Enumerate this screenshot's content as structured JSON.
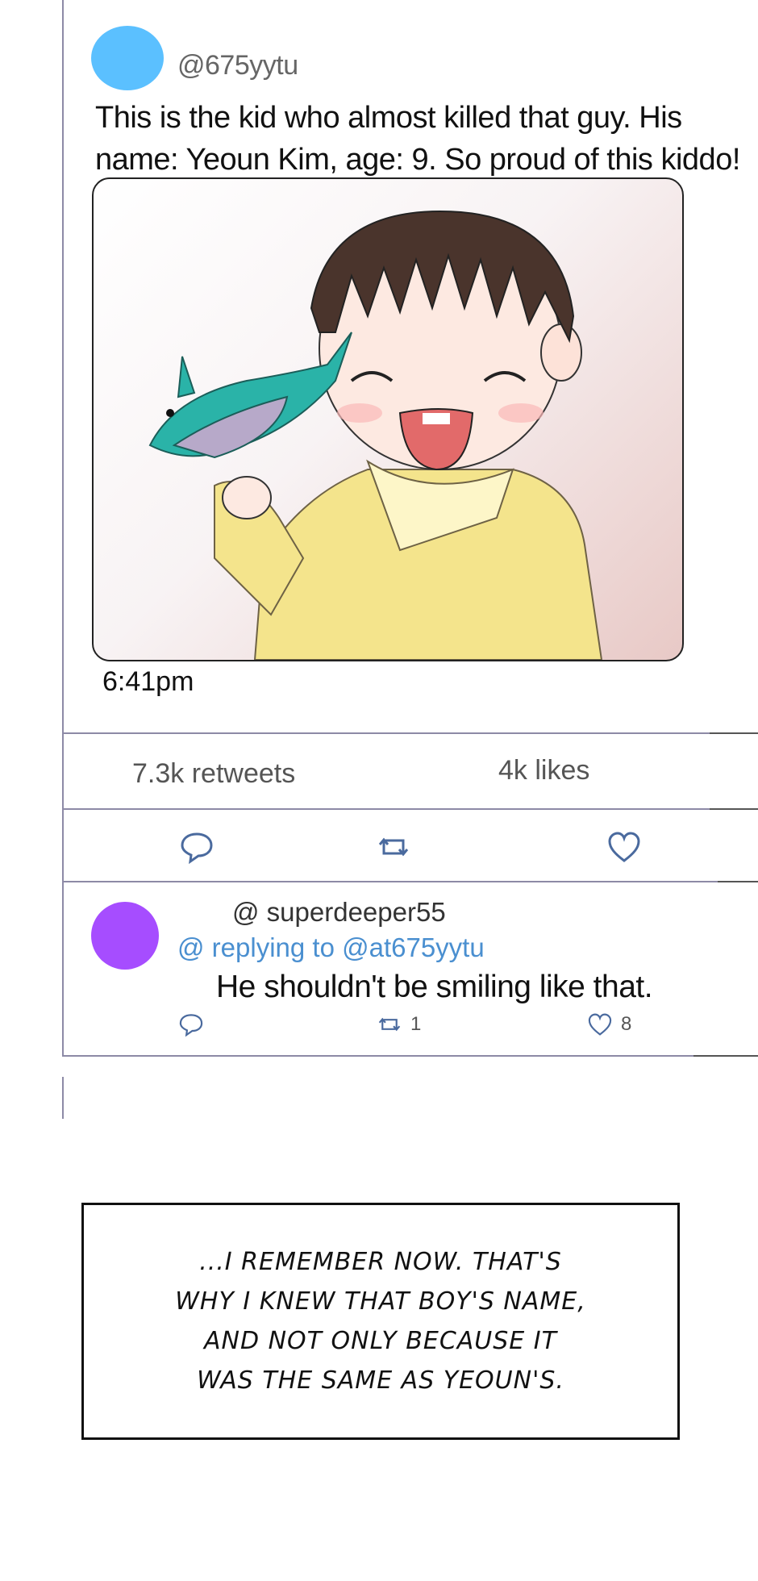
{
  "tweet": {
    "handle": "@675yytu",
    "text": "This is the kid who almost killed that guy. His name: Yeoun Kim, age: 9. So proud of this kiddo!",
    "timestamp": "6:41pm",
    "avatar_color": "#5bc0ff",
    "stats": {
      "retweets": "7.3k retweets",
      "likes": "4k likes"
    },
    "actions": {
      "reply_icon": "reply-icon",
      "retweet_icon": "retweet-icon",
      "like_icon": "heart-icon"
    }
  },
  "reply": {
    "handle": "@ superdeeper55",
    "replying_to": "@ replying to @at675yytu",
    "text": "He shouldn't be smiling like that.",
    "avatar_color": "#a64dff",
    "retweet_count": "1",
    "like_count": "8"
  },
  "narration": {
    "lines": [
      "...I REMEMBER NOW. THAT'S",
      "WHY I KNEW THAT BOY'S NAME,",
      "AND NOT ONLY BECAUSE IT",
      "WAS THE SAME AS YEOUN'S."
    ]
  },
  "colors": {
    "divider": "#8d8aa6",
    "link": "#4a8fd0",
    "icon": "#4a6a9e"
  }
}
